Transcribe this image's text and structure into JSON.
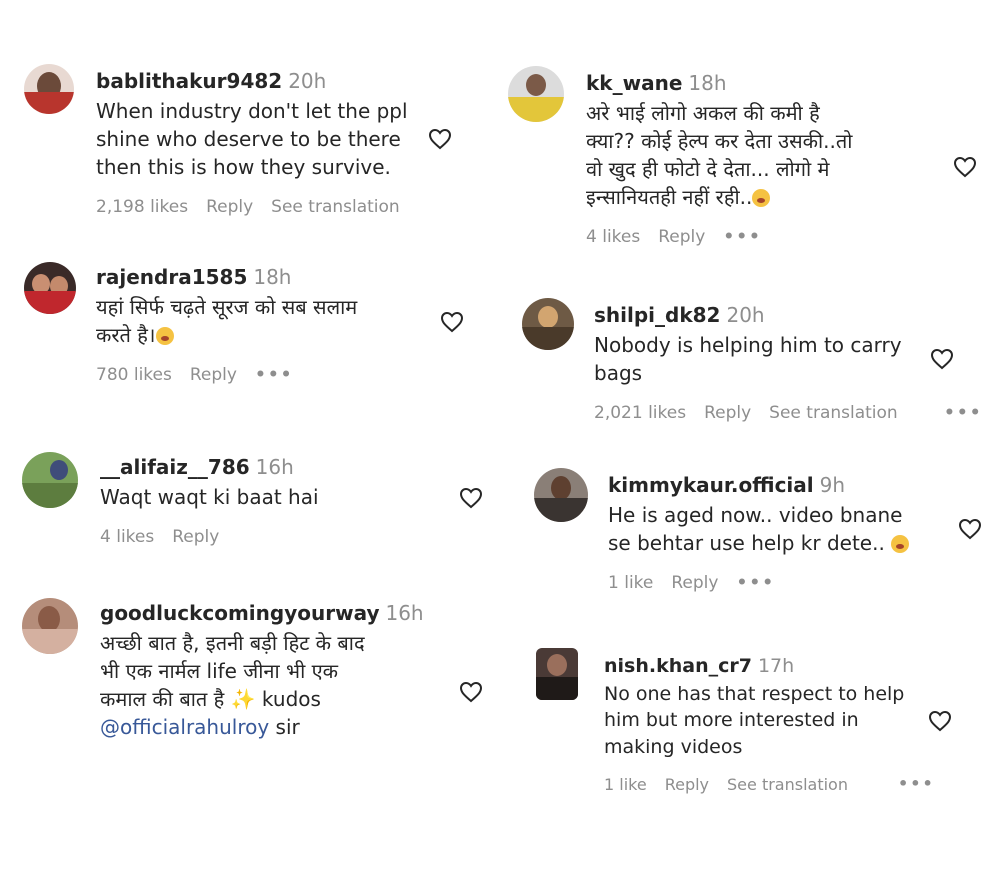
{
  "comments": [
    {
      "user": "bablithakur9482",
      "time": "20h",
      "lines": [
        "When industry don't let the ppl",
        "shine who deserve to be there",
        "then this is how they survive."
      ],
      "likes": "2,198 likes",
      "reply": "Reply",
      "translate": "See translation"
    },
    {
      "user": "rajendra1585",
      "time": "18h",
      "lines": [
        "यहां सिर्फ चढ़ते सूरज को सब सलाम",
        "करते है।"
      ],
      "likes": "780 likes",
      "reply": "Reply",
      "more": "•••"
    },
    {
      "user": "__alifaiz__786",
      "time": "16h",
      "lines": [
        "Waqt waqt ki baat hai"
      ],
      "likes": "4 likes",
      "reply": "Reply"
    },
    {
      "user": "goodluckcomingyourway",
      "time": "16h",
      "lines": [
        "अच्छी बात है, इतनी बड़ी हिट के बाद",
        "भी एक नार्मल life जीना भी एक",
        "कमाल की बात है"
      ],
      "extra": "kudos",
      "mention": "@officialrahulroy",
      "mention_suffix": " sir"
    },
    {
      "user": "kk_wane",
      "time": "18h",
      "lines": [
        "अरे भाई लोगो अकल की कमी है",
        "क्या?? कोई हेल्प कर देता उसकी..तो",
        "वो खुद ही फोटो दे देता... लोगो मे",
        "इन्सानियतही नहीं रही.."
      ],
      "likes": "4 likes",
      "reply": "Reply",
      "more": "•••"
    },
    {
      "user": "shilpi_dk82",
      "time": "20h",
      "lines": [
        "Nobody is helping him to carry",
        "bags"
      ],
      "likes": "2,021 likes",
      "reply": "Reply",
      "translate": "See translation",
      "more": "•••"
    },
    {
      "user": "kimmykaur.official",
      "time": "9h",
      "lines": [
        "He is aged now.. video bnane",
        "se behtar use help kr dete.."
      ],
      "likes": "1 like",
      "reply": "Reply",
      "more": "•••"
    },
    {
      "user": "nish.khan_cr7",
      "time": "17h",
      "lines": [
        "No one has that respect to help",
        "him but more interested in",
        "making videos"
      ],
      "likes": "1 like",
      "reply": "Reply",
      "translate": "See translation",
      "more": "•••"
    }
  ],
  "colors": {
    "text": "#262626",
    "muted": "#8e8e8e",
    "mention": "#385898"
  },
  "icons": {
    "like": "heart-outline-icon",
    "emoji": "emoji-icon",
    "sparkle": "sparkles-icon"
  }
}
